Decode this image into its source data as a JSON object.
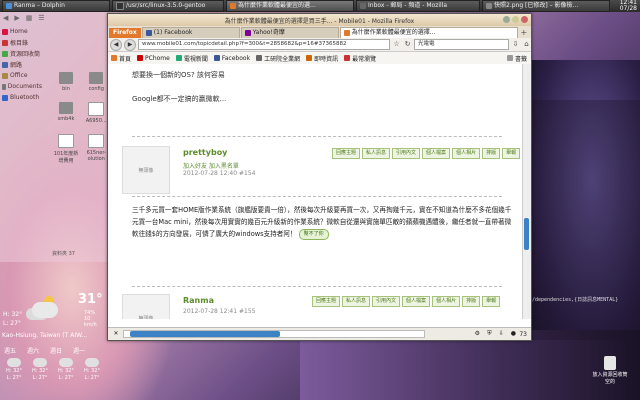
{
  "taskbar": {
    "items": [
      {
        "label": "Ranma – Dolphin",
        "color": "#4a90d9"
      },
      {
        "label": "/usr/src/linux-3.5.0-gentoo",
        "color": "#333"
      },
      {
        "label": "為什麼作業軟體最便宜的選...",
        "color": "#e2782b"
      },
      {
        "label": "Inbox - 郵局 - 頻道 - Mozilla",
        "color": "#666"
      },
      {
        "label": "快照2.png [已修改] – 影像檢...",
        "color": "#888"
      }
    ],
    "clock_time": "12:41",
    "clock_date": "07/28"
  },
  "dolphin": {
    "places": [
      {
        "label": "Home",
        "color": "#d14"
      },
      {
        "label": "根目錄",
        "color": "#c33"
      },
      {
        "label": "資源回收筒",
        "color": "#4a4"
      },
      {
        "label": "網路",
        "color": "#46a"
      },
      {
        "label": "Office",
        "color": "#a84"
      },
      {
        "label": "Documents",
        "color": "#777"
      },
      {
        "label": "Bluetooth",
        "color": "#36c"
      }
    ],
    "files": [
      "bin",
      "config",
      "smb4k",
      "A6950...",
      "101年度新增費用",
      "615ner-olution",
      "101年度繳費通知單"
    ],
    "status": "資料夾  37"
  },
  "weather": {
    "temp": "31°",
    "high": "H: 32°",
    "low": "L: 27°",
    "humidity": "74%",
    "pressure": "10 km/h",
    "location": "Kao-Hsiung, Taiwan (T AIW...",
    "days": [
      "週五",
      "週六",
      "週日",
      "週一"
    ],
    "forecast": [
      {
        "h": "H: 32°",
        "l": "L: 27°"
      },
      {
        "h": "H: 32°",
        "l": "L: 27°"
      },
      {
        "h": "H: 32°",
        "l": "L: 27°"
      },
      {
        "h": "H: 32°",
        "l": "L: 27°"
      }
    ]
  },
  "firefox": {
    "title": "為什麼作業軟體最便宜的選擇是買三手... - Mobile01 - Mozilla Firefox",
    "menu_label": "Firefox",
    "tabs": [
      {
        "label": "(1) Facebook",
        "active": false,
        "color": "#3b5998"
      },
      {
        "label": "Yahoo!奇摩",
        "active": false,
        "color": "#7b0099"
      },
      {
        "label": "為什麼作業軟體最便宜的選擇...",
        "active": true,
        "color": "#e2782b"
      }
    ],
    "url": "www.mobile01.com/topicdetail.php?f=300&t=2858682&p=16#37365882",
    "search": "光電電",
    "bookmarks": [
      {
        "label": "首頁",
        "color": "#e2782b"
      },
      {
        "label": "PChome",
        "color": "#c00"
      },
      {
        "label": "電視新聞",
        "color": "#2a7"
      },
      {
        "label": "Facebook",
        "color": "#3b5998"
      },
      {
        "label": "工研院全業網",
        "color": "#666"
      },
      {
        "label": "即時資訊",
        "color": "#c60"
      },
      {
        "label": "最常瀏覽",
        "color": "#c33"
      }
    ],
    "bm_extra": "書籤"
  },
  "page": {
    "intro_line1": "想要換一個新的OS? 該何容易",
    "intro_line2": "Google都不一定搞的贏微軟...",
    "posts": [
      {
        "avatar": "無頭像",
        "user": "prettyboy",
        "links": "加入好友  加入黑名單",
        "time": "2012-07-28 12:40  #154",
        "actions": [
          "回應主題",
          "私人訊息",
          "引用內文",
          "個人檔案",
          "個人相片",
          "排版",
          "舉報"
        ],
        "body": "三千多元買一套HOME版作業系統（旗艦版要貴一倍），然後每次升級要再買一次，又再掏幾千元，實在不知道為什麼不多花個幾千元買一台Mac mini，然後每次用實實的幾百元升級新的作業系統？微軟自從還與實施單匹敵的蘋蘋機遇體後，繼任者就一直帶著微軟往錢$的方向發展，可憐了廣大的windows支持者阿！",
        "help": "幫不了你"
      },
      {
        "avatar": "無頭像",
        "user": "Ranma",
        "links": "",
        "time": "2012-07-28 12:41  #155",
        "actions": [
          "回應主題",
          "私人訊息",
          "引用內文",
          "個人檔案",
          "個人相片",
          "排版",
          "舉報"
        ],
        "body": "",
        "help": ""
      }
    ]
  },
  "status": {
    "count": "73"
  },
  "terminal": {
    "line": "/dependencies,{日誌訊息MENTAL}"
  },
  "trash": {
    "label": "放入資源回收筒",
    "sub": "空的"
  }
}
